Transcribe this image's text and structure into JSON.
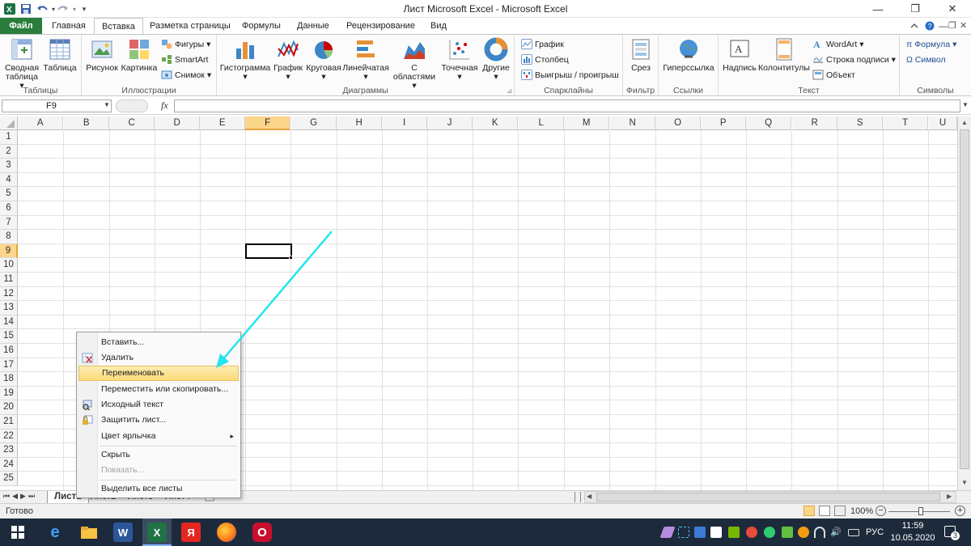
{
  "window": {
    "title": "Лист Microsoft Excel  -  Microsoft Excel",
    "minimize": "—",
    "restore": "❐",
    "close": "✕"
  },
  "tabs": [
    "Файл",
    "Главная",
    "Вставка",
    "Разметка страницы",
    "Формулы",
    "Данные",
    "Рецензирование",
    "Вид"
  ],
  "ribbon": {
    "groups": {
      "tables": "Таблицы",
      "illustrations": "Иллюстрации",
      "charts": "Диаграммы",
      "sparklines": "Спарклайны",
      "filter": "Фильтр",
      "links": "Ссылки",
      "text": "Текст",
      "symbols": "Символы"
    },
    "pivot": "Сводная таблица ▾",
    "table": "Таблица",
    "picture": "Рисунок",
    "clipart": "Картинка",
    "shapes": "Фигуры ▾",
    "smartart": "SmartArt",
    "screenshot": "Снимок ▾",
    "histogram": "Гистограмма ▾",
    "line_chart": "График ▾",
    "pie_chart": "Круговая ▾",
    "bar_chart": "Линейчатая ▾",
    "area_chart": "С областями ▾",
    "scatter_chart": "Точечная ▾",
    "other_charts": "Другие ▾",
    "spark_line": "График",
    "spark_column": "Столбец",
    "spark_winloss": "Выигрыш / проигрыш",
    "slicer": "Срез",
    "hyperlink": "Гиперссылка",
    "textbox": "Надпись",
    "headerfooter": "Колонтитулы",
    "wordart": "WordArt ▾",
    "signature": "Строка подписи ▾",
    "object": "Объект",
    "formula": "π Формула ▾",
    "symbol": "Ω Символ"
  },
  "formula_bar": {
    "namebox": "F9",
    "fx": "fx"
  },
  "columns": [
    "A",
    "B",
    "C",
    "D",
    "E",
    "F",
    "G",
    "H",
    "I",
    "J",
    "K",
    "L",
    "M",
    "N",
    "O",
    "P",
    "Q",
    "R",
    "S",
    "T",
    "U"
  ],
  "rows": [
    "1",
    "2",
    "3",
    "4",
    "5",
    "6",
    "7",
    "8",
    "9",
    "10",
    "11",
    "12",
    "13",
    "14",
    "15",
    "16",
    "17",
    "18",
    "19",
    "20",
    "21",
    "22",
    "23",
    "24",
    "25"
  ],
  "context_menu": {
    "items": [
      {
        "label": "Вставить...",
        "icon": "none",
        "state": "normal"
      },
      {
        "label": "Удалить",
        "icon": "delete-sheet-icon",
        "state": "normal"
      },
      {
        "label": "Переименовать",
        "icon": "none",
        "state": "highlighted"
      },
      {
        "label": "Переместить или скопировать...",
        "icon": "none",
        "state": "normal"
      },
      {
        "label": "Исходный текст",
        "icon": "view-code-icon",
        "state": "normal"
      },
      {
        "label": "Защитить лист...",
        "icon": "protect-sheet-icon",
        "state": "normal"
      },
      {
        "label": "Цвет ярлычка",
        "icon": "none",
        "state": "submenu"
      },
      {
        "label": "Скрыть",
        "icon": "none",
        "state": "normal"
      },
      {
        "label": "Показать...",
        "icon": "none",
        "state": "disabled"
      },
      {
        "label": "Выделить все листы",
        "icon": "none",
        "state": "normal"
      }
    ],
    "submenu_arrow": "▸"
  },
  "sheets": [
    "Лист1",
    "Лист2",
    "Лист3",
    "Лист4"
  ],
  "status": {
    "ready": "Готово",
    "zoom": "100%"
  },
  "taskbar": {
    "time": "11:59",
    "date": "10.05.2020",
    "lang": "РУС",
    "notifications": "3"
  },
  "colors": {
    "file_tab": "#2a7d3c",
    "selection_header": "#fbd589",
    "arrow": "#22e5ee",
    "taskbar": "#1d2a3b"
  }
}
